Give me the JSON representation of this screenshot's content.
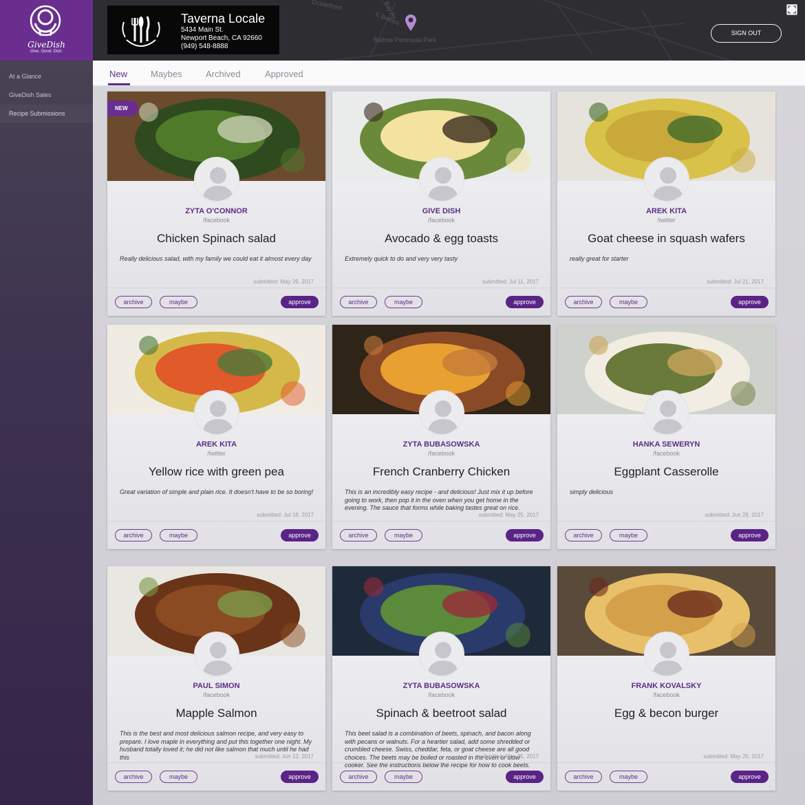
{
  "brand": {
    "name": "GiveDish",
    "tagline": "Give. Good. Dish."
  },
  "sidebar": {
    "items": [
      {
        "label": "At a Glance",
        "active": false
      },
      {
        "label": "GiveDish Sales",
        "active": false
      },
      {
        "label": "Recipe Submissions",
        "active": true
      }
    ]
  },
  "header": {
    "restaurant": {
      "name": "Taverna Locale",
      "street": "5434 Main St.",
      "city": "Newport Beach, CA 92660",
      "phone": "(949) 548-8888"
    },
    "map_labels": [
      "Oceanfront",
      "E Bay Av",
      "E Balboa",
      "Balboa Peninsula Park"
    ],
    "signout_label": "SIGN OUT"
  },
  "tabs": [
    {
      "label": "New",
      "active": true
    },
    {
      "label": "Maybes",
      "active": false
    },
    {
      "label": "Archived",
      "active": false
    },
    {
      "label": "Approved",
      "active": false
    }
  ],
  "colors": {
    "accent": "#5a2486",
    "brand": "#6a2f8e"
  },
  "cards": [
    {
      "new_badge": "NEW",
      "author": "ZYTA O'CONNOR",
      "source": "/facebook",
      "title": "Chicken Spinach salad",
      "description": "Really delicious salad, with my family we could eat it almost every day",
      "submitted": "submitted: May 26, 2017",
      "archive": "archive",
      "maybe": "maybe",
      "approve": "approve"
    },
    {
      "new_badge": "",
      "author": "GIVE DISH",
      "source": "/facebook",
      "title": "Avocado & egg toasts",
      "description": "Extremely quick to do and very very tasty",
      "submitted": "submitted: Jul 11, 2017",
      "archive": "archive",
      "maybe": "maybe",
      "approve": "approve"
    },
    {
      "new_badge": "",
      "author": "AREK KITA",
      "source": "/twitter",
      "title": "Goat cheese in squash wafers",
      "description": "really great for starter",
      "submitted": "submitted: Jul 21, 2017",
      "archive": "archive",
      "maybe": "maybe",
      "approve": "approve"
    },
    {
      "new_badge": "",
      "author": "AREK KITA",
      "source": "/twitter",
      "title": "Yellow rice with green pea",
      "description": "Great variation of simple and plain rice. It doesn't have to be so boring!",
      "submitted": "submitted: Jul 18, 2017",
      "archive": "archive",
      "maybe": "maybe",
      "approve": "approve"
    },
    {
      "new_badge": "",
      "author": "ZYTA BUBASOWSKA",
      "source": "/facebook",
      "title": "French Cranberry Chicken",
      "description": "This is an incredibly easy recipe - and delicious! Just mix it up before going to work, then pop it in the oven when you get home in the evening. The sauce that forms while baking tastes great on rice.",
      "submitted": "submitted: May 25, 2017",
      "archive": "archive",
      "maybe": "maybe",
      "approve": "approve"
    },
    {
      "new_badge": "",
      "author": "HANKA SEWERYN",
      "source": "/facebook",
      "title": "Eggplant Casserolle",
      "description": "simply delicious",
      "submitted": "submitted: Jun 28, 2017",
      "archive": "archive",
      "maybe": "maybe",
      "approve": "approve"
    },
    {
      "new_badge": "",
      "author": "PAUL SIMON",
      "source": "/facebook",
      "title": "Mapple Salmon",
      "description": "This is the best and most delicious salmon recipe, and very easy to prepare. I love maple in everything and put this together one night. My husband totally loved it; he did not like salmon that much until he had this",
      "submitted": "submitted: Jun 13, 2017",
      "archive": "archive",
      "maybe": "maybe",
      "approve": "approve"
    },
    {
      "new_badge": "",
      "author": "ZYTA BUBASOWSKA",
      "source": "/facebook",
      "title": "Spinach & beetroot salad",
      "description": "This beet salad is a combination of beets, spinach, and bacon along with pecans or walnuts. For a heartier salad, add some shredded or crumbled cheese. Swiss, cheddar, feta, or goat cheese are all good choices. The beets may be boiled or roasted in the oven or slow cooker. See the instructions below the recipe for how to cook beets.",
      "submitted": "submitted: May 25, 2017",
      "archive": "archive",
      "maybe": "maybe",
      "approve": "approve"
    },
    {
      "new_badge": "",
      "author": "FRANK KOVALSKY",
      "source": "/facebook",
      "title": "Egg & becon burger",
      "description": "",
      "submitted": "submitted: May 25, 2017",
      "archive": "archive",
      "maybe": "maybe",
      "approve": "approve"
    }
  ]
}
